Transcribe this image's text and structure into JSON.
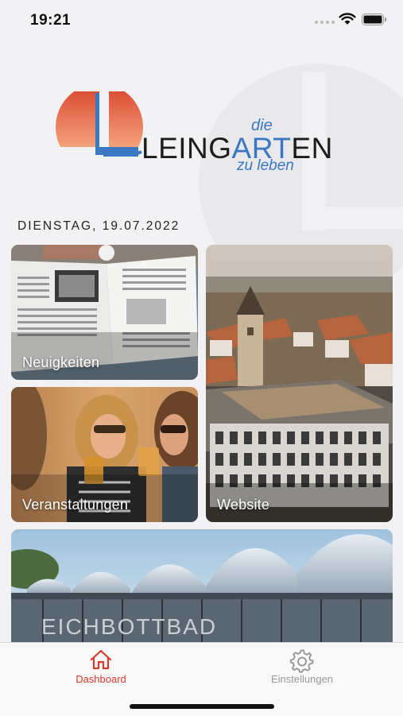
{
  "status_bar": {
    "time": "19:21"
  },
  "header": {
    "logo_text_prefix": "LEING",
    "logo_text_accent": "ART",
    "logo_text_suffix": "EN",
    "logo_tagline_top": "die",
    "logo_tagline_bottom": "zu leben"
  },
  "date_label": "DIENSTAG, 19.07.2022",
  "tiles": {
    "news": {
      "label": "Neuigkeiten"
    },
    "events": {
      "label": "Veranstaltungen"
    },
    "website": {
      "label": "Website"
    },
    "pool": {
      "sign_text": "EICHBOTTBAD"
    }
  },
  "tab_bar": {
    "dashboard_label": "Dashboard",
    "settings_label": "Einstellungen"
  },
  "colors": {
    "accent_red": "#d53a2c",
    "logo_blue": "#3b78c2",
    "logo_orange": "#e05a36"
  }
}
